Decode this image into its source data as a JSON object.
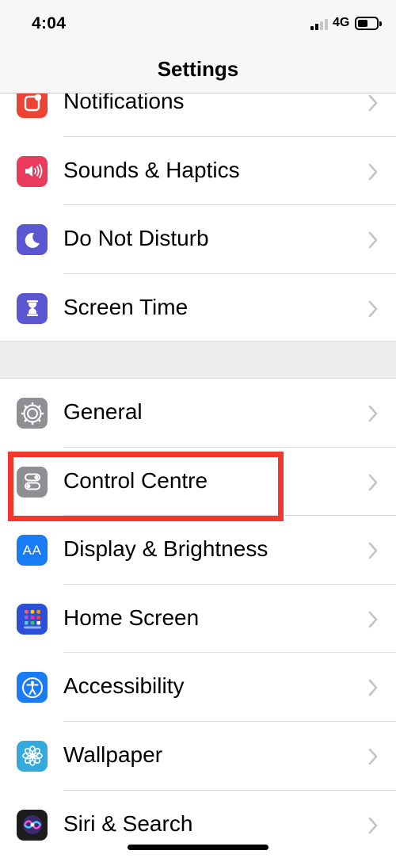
{
  "status_bar": {
    "time": "4:04",
    "network": "4G"
  },
  "nav": {
    "title": "Settings"
  },
  "groups": [
    {
      "items": [
        {
          "label": "Notifications",
          "icon": "notifications-icon",
          "color": "#eb4335"
        },
        {
          "label": "Sounds & Haptics",
          "icon": "speaker-icon",
          "color": "#ec3a5c"
        },
        {
          "label": "Do Not Disturb",
          "icon": "moon-icon",
          "color": "#5b57d1"
        },
        {
          "label": "Screen Time",
          "icon": "hourglass-icon",
          "color": "#5b57d1"
        }
      ]
    },
    {
      "items": [
        {
          "label": "General",
          "icon": "gear-icon",
          "color": "#8e8e93"
        },
        {
          "label": "Control Centre",
          "icon": "toggles-icon",
          "color": "#8e8e93",
          "highlighted": true
        },
        {
          "label": "Display & Brightness",
          "icon": "text-size-icon",
          "color": "#1a7cf5"
        },
        {
          "label": "Home Screen",
          "icon": "app-grid-icon",
          "color": "#2b4fd6"
        },
        {
          "label": "Accessibility",
          "icon": "accessibility-icon",
          "color": "#1a7cf5"
        },
        {
          "label": "Wallpaper",
          "icon": "flower-icon",
          "color": "#34aadc"
        },
        {
          "label": "Siri & Search",
          "icon": "siri-icon",
          "color": "#1c1c1e"
        }
      ]
    }
  ],
  "icon_texts": {
    "display": "AA"
  },
  "highlight_color": "#f0392c"
}
